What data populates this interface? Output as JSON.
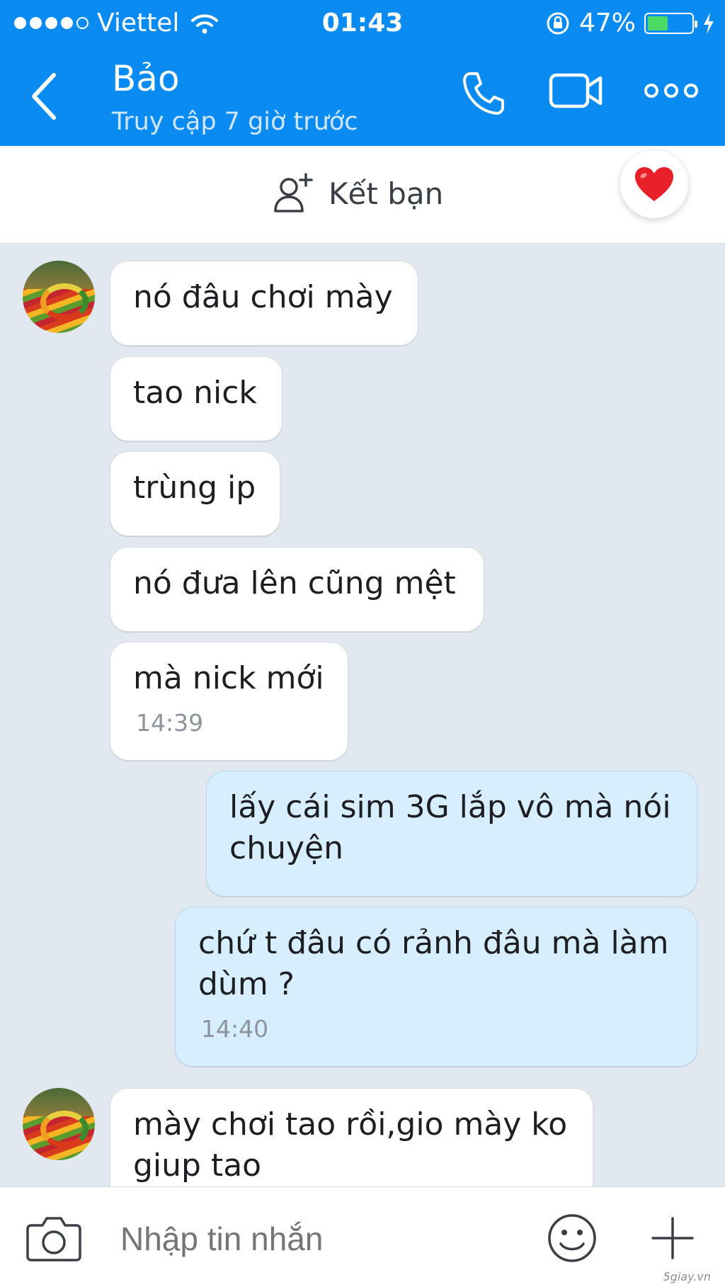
{
  "status_bar": {
    "carrier": "Viettel",
    "time": "01:43",
    "battery": "47%",
    "battery_level": 0.47,
    "signal_bars_filled": 4,
    "signal_bars_total": 5
  },
  "header": {
    "title": "Bảo",
    "subtitle": "Truy cập 7 giờ trước"
  },
  "friend_bar": {
    "label": "Kết bạn"
  },
  "messages": [
    {
      "side": "in",
      "text": "nó đâu chơi mày"
    },
    {
      "side": "in",
      "text": "tao nick"
    },
    {
      "side": "in",
      "text": "trùng ip"
    },
    {
      "side": "in",
      "text": "nó đưa lên cũng mệt"
    },
    {
      "side": "in",
      "text": "mà nick mới",
      "time": "14:39"
    },
    {
      "side": "out",
      "text_line1": "lấy cái sim 3G lắp vô mà nói",
      "text_line2": "chuyện"
    },
    {
      "side": "out",
      "text_line1": "chứ t đâu có rảnh đâu mà làm",
      "text_line2": "dùm ?",
      "time": "14:40"
    },
    {
      "side": "in",
      "text_line1": "mày chơi tao rồi,gio mày ko",
      "text_line2": "giup tao"
    }
  ],
  "input": {
    "placeholder": "Nhập tin nhắn"
  },
  "watermark": "5giay.vn",
  "colors": {
    "header": "#0a8bf2",
    "background": "#e2e8ef",
    "outgoing_bubble": "#d6eefe",
    "incoming_bubble": "#ffffff",
    "battery_fill": "#4cd964",
    "heart": "#e8202a"
  }
}
